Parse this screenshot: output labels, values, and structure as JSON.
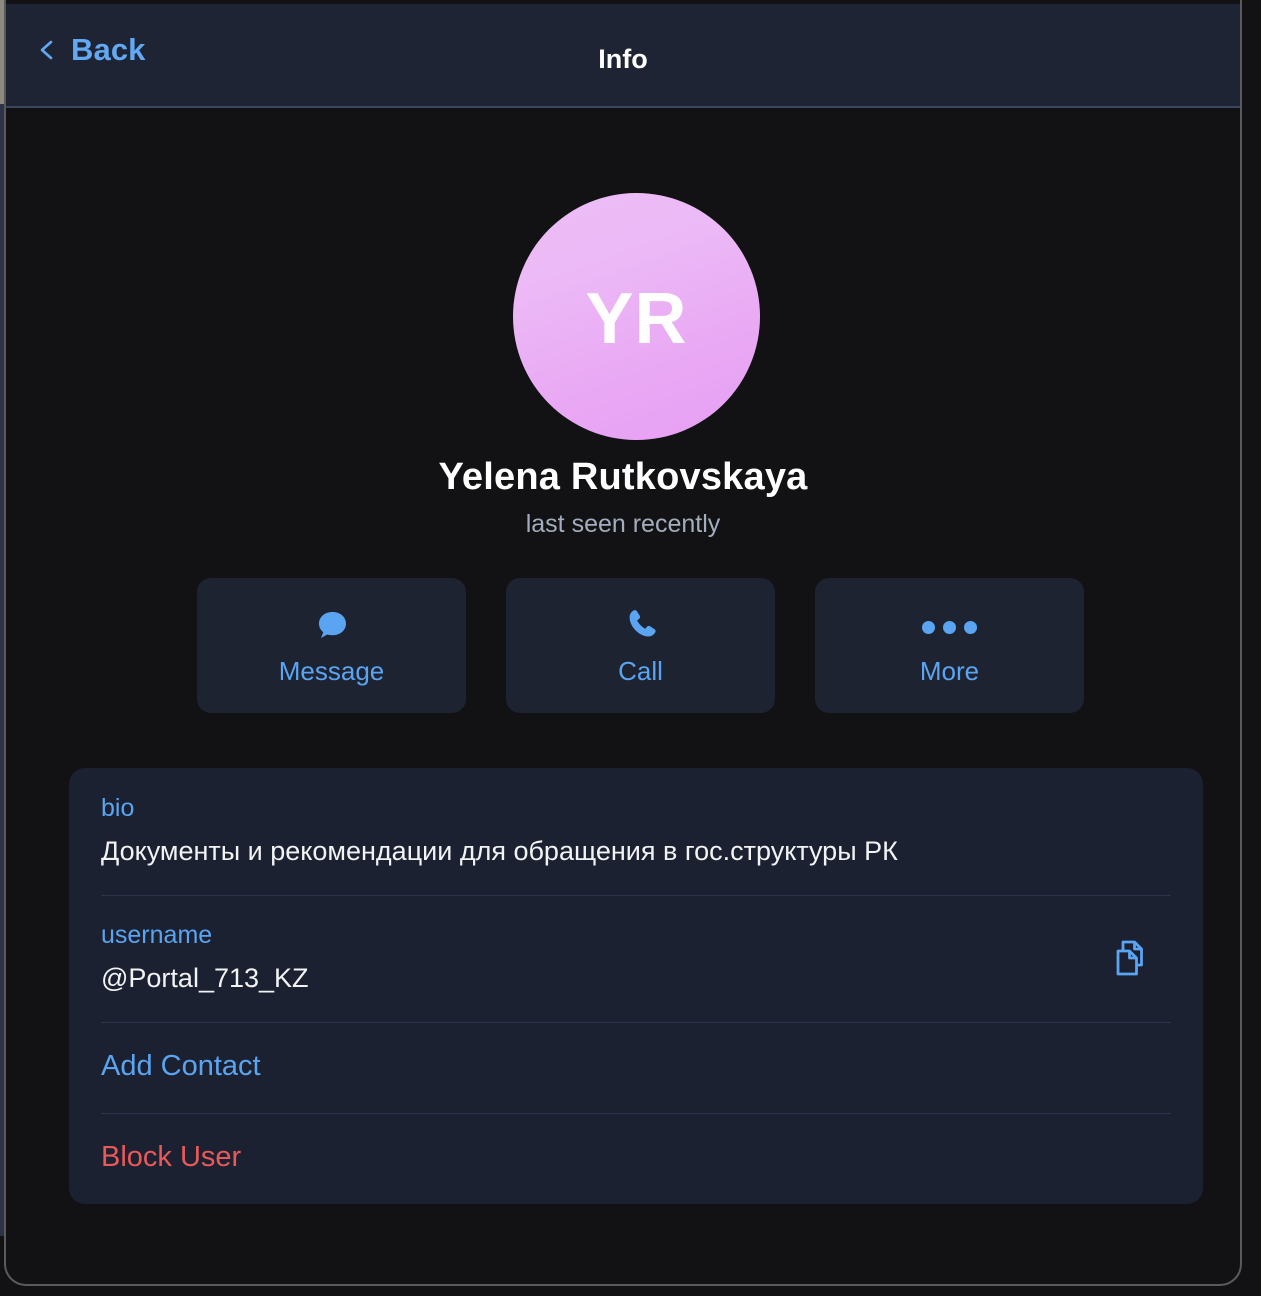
{
  "window": {
    "background_color": "#121214"
  },
  "header": {
    "back_label": "Back",
    "back_icon": "chevron-left-icon",
    "title": "Info",
    "background_color": "#1e2433",
    "accent_color": "#62a8f3"
  },
  "profile": {
    "avatar_initials": "YR",
    "avatar_gradient_from": "#edbdf6",
    "avatar_gradient_to": "#e79ff3",
    "name": "Yelena Rutkovskaya",
    "status": "last seen recently"
  },
  "actions": [
    {
      "label": "Message",
      "icon": "chat-bubble-icon"
    },
    {
      "label": "Call",
      "icon": "phone-icon"
    },
    {
      "label": "More",
      "icon": "ellipsis-icon"
    }
  ],
  "info_card": {
    "background_color": "#1b2130",
    "fields": [
      {
        "label": "bio",
        "value": "Документы и рекомендации для обращения в гос.структуры РК",
        "has_copy": false
      },
      {
        "label": "username",
        "value": "@Portal_713_KZ",
        "has_copy": true,
        "copy_icon": "copy-icon"
      }
    ],
    "links": [
      {
        "label": "Add Contact",
        "color": "#5aa4f2",
        "kind": "add-contact"
      },
      {
        "label": "Block User",
        "color": "#e8595a",
        "kind": "block-user"
      }
    ]
  }
}
